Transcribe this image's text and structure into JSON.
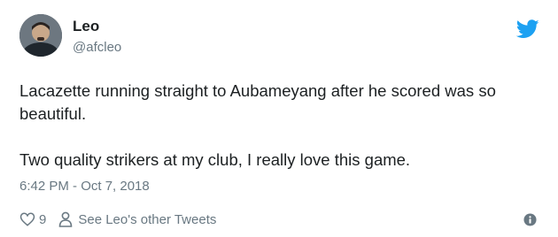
{
  "user": {
    "name": "Leo",
    "handle": "@afcleo"
  },
  "tweet": {
    "paragraphs": [
      "Lacazette running straight to Aubameyang after he scored was so beautiful.",
      "Two quality strikers at my club, I really love this game."
    ],
    "timestamp": "6:42 PM - Oct 7, 2018"
  },
  "actions": {
    "like_count": "9",
    "see_more_label": "See Leo's other Tweets"
  },
  "icons": {
    "brand": "twitter-bird-icon",
    "like": "heart-icon",
    "profile": "person-icon",
    "info": "info-icon"
  },
  "colors": {
    "text": "#1c2022",
    "muted": "#697882",
    "twitter_blue": "#1da1f2"
  }
}
